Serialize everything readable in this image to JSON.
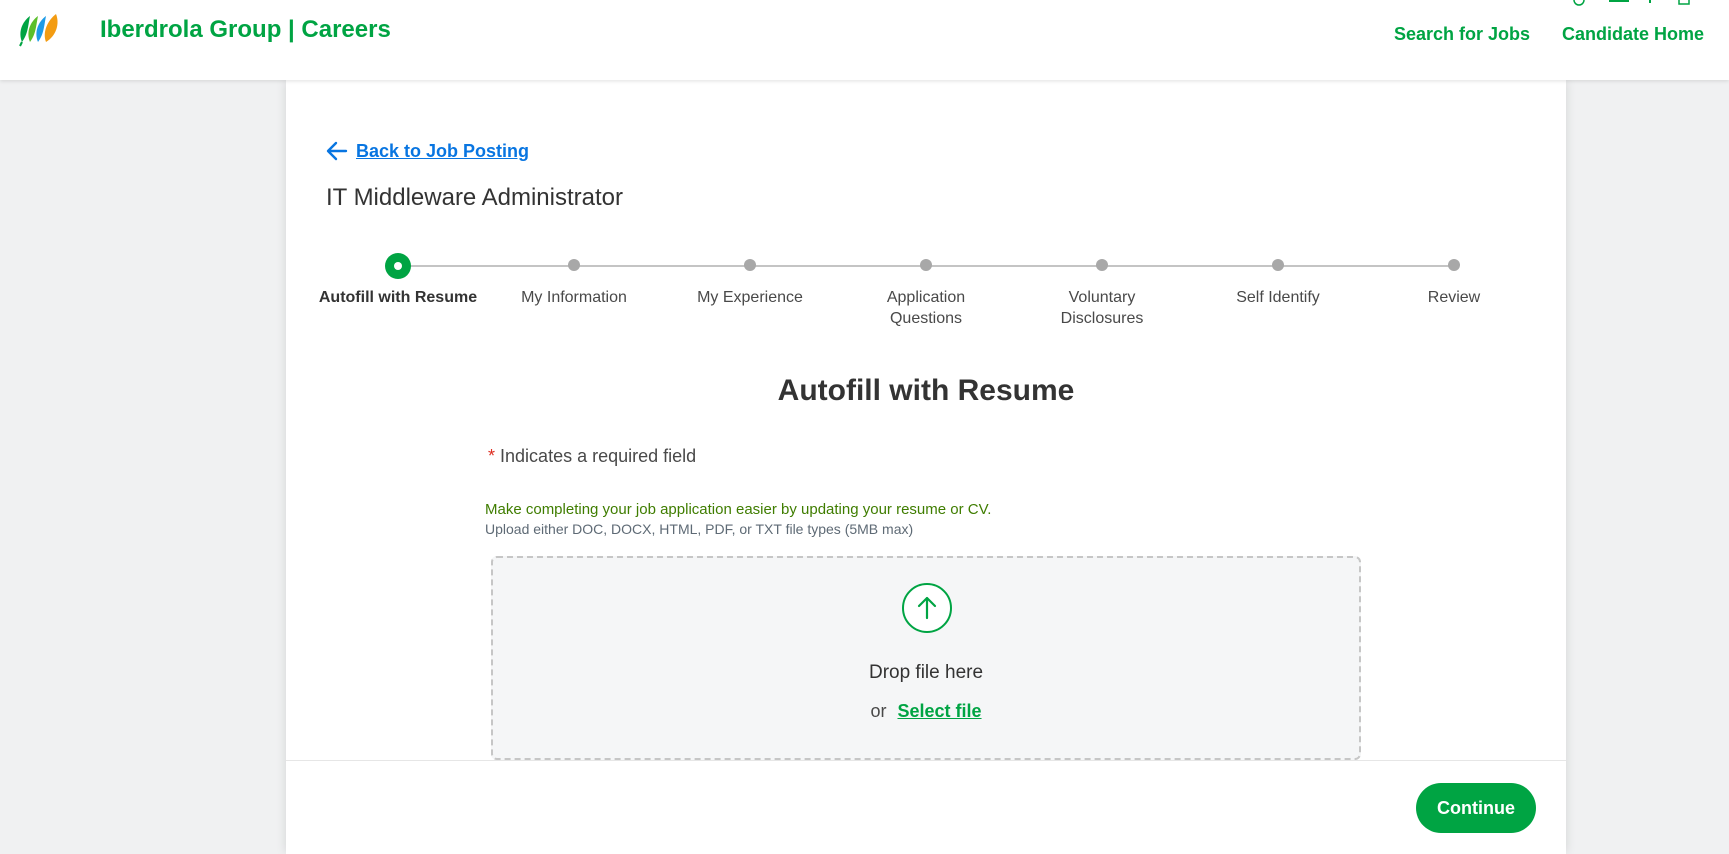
{
  "header": {
    "brand": "Iberdrola Group | Careers",
    "nav": {
      "search_jobs": "Search for Jobs",
      "candidate_home": "Candidate Home"
    },
    "logo_colors": [
      "#00a443",
      "#5bbf2b",
      "#1d9be7",
      "#f39c12"
    ]
  },
  "page": {
    "back_link": "Back to Job Posting",
    "job_title": "IT Middleware Administrator"
  },
  "steps": [
    {
      "label": "Autofill with Resume",
      "current": true
    },
    {
      "label": "My Information",
      "current": false
    },
    {
      "label": "My Experience",
      "current": false
    },
    {
      "label": "Application Questions",
      "current": false
    },
    {
      "label": "Voluntary Disclosures",
      "current": false
    },
    {
      "label": "Self Identify",
      "current": false
    },
    {
      "label": "Review",
      "current": false
    }
  ],
  "form": {
    "section_title": "Autofill with Resume",
    "required_star": "*",
    "required_note": "Indicates a required field",
    "hint_primary": "Make completing your job application easier by updating your resume or CV.",
    "hint_secondary": "Upload either DOC, DOCX, HTML, PDF, or TXT file types (5MB max)",
    "dropzone": {
      "label": "Drop file here",
      "or": "or",
      "select_file": "Select file",
      "icon": "upload-arrow-icon"
    }
  },
  "footer": {
    "continue": "Continue"
  },
  "colors": {
    "brand_green": "#00a443",
    "link_blue": "#0875e1",
    "hint_green": "#3f7d00"
  }
}
